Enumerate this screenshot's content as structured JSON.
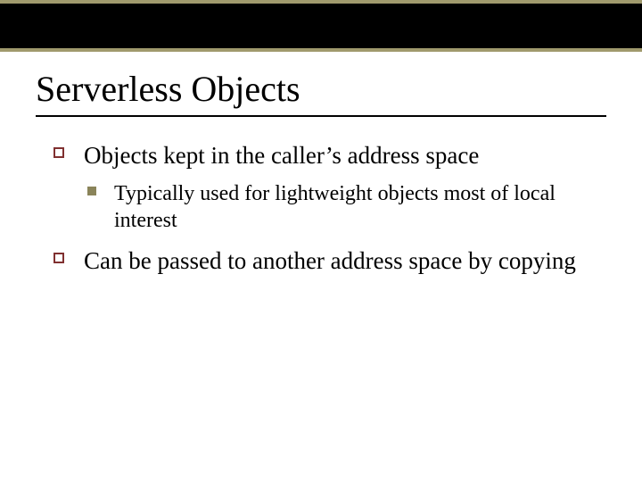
{
  "title": "Serverless Objects",
  "bullets": [
    {
      "text": "Objects kept in the caller’s address space",
      "children": [
        {
          "text": "Typically used for lightweight objects most of local interest"
        }
      ]
    },
    {
      "text": "Can be passed to another address space by copying",
      "children": []
    }
  ],
  "theme": {
    "accent_band": "#a09a6d",
    "bullet_outline": "#803030",
    "bullet_fill": "#8a845a"
  }
}
